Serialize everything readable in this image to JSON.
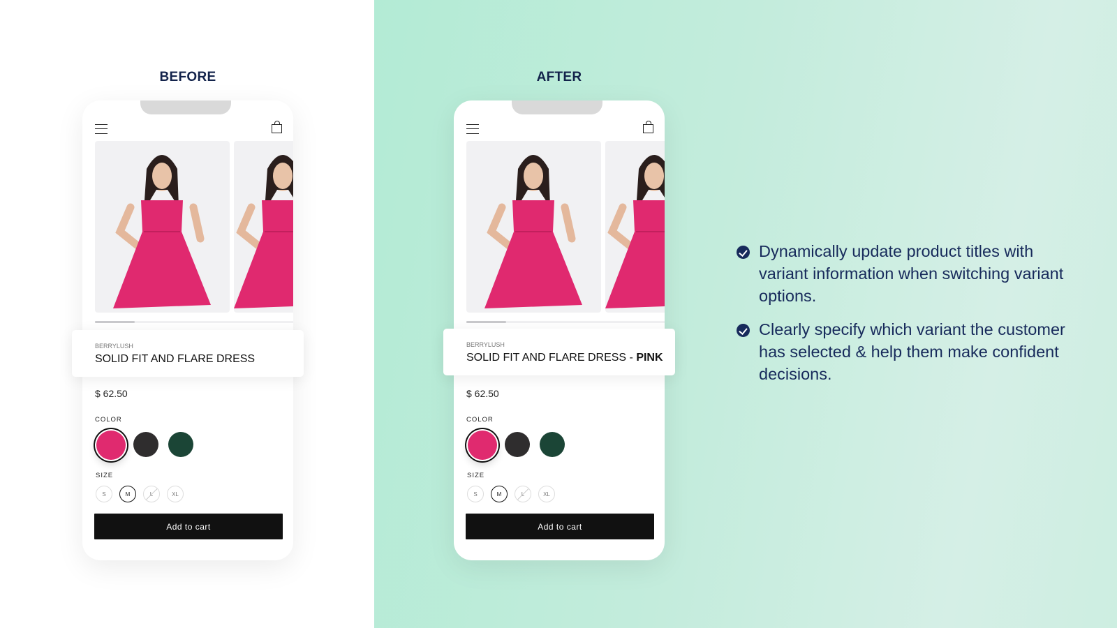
{
  "before": {
    "label": "BEFORE",
    "vendor": "BERRYLUSH",
    "title": "SOLID FIT AND FLARE DRESS",
    "title_variant": "",
    "price": "$ 62.50",
    "color_label": "COLOR",
    "size_label": "SIZE",
    "colors": [
      "#e02a6f",
      "#2f2d2e",
      "#1b4536"
    ],
    "sizes": [
      "S",
      "M",
      "L",
      "XL"
    ],
    "selected_size": "M",
    "unavailable_size": "L",
    "cart": "Add to cart"
  },
  "after": {
    "label": "AFTER",
    "vendor": "BERRYLUSH",
    "title": "SOLID FIT AND FLARE DRESS - ",
    "title_variant": "PINK",
    "price": "$ 62.50",
    "color_label": "COLOR",
    "size_label": "SIZE",
    "colors": [
      "#e02a6f",
      "#2f2d2e",
      "#1b4536"
    ],
    "sizes": [
      "S",
      "M",
      "L",
      "XL"
    ],
    "selected_size": "M",
    "unavailable_size": "L",
    "cart": "Add to cart"
  },
  "features": [
    {
      "icon": "check-circle-icon",
      "text": "Dynamically update product titles with variant information when switching variant options."
    },
    {
      "icon": "check-circle-icon",
      "text": "Clearly specify which variant the customer has selected & help them make confident decisions."
    }
  ]
}
